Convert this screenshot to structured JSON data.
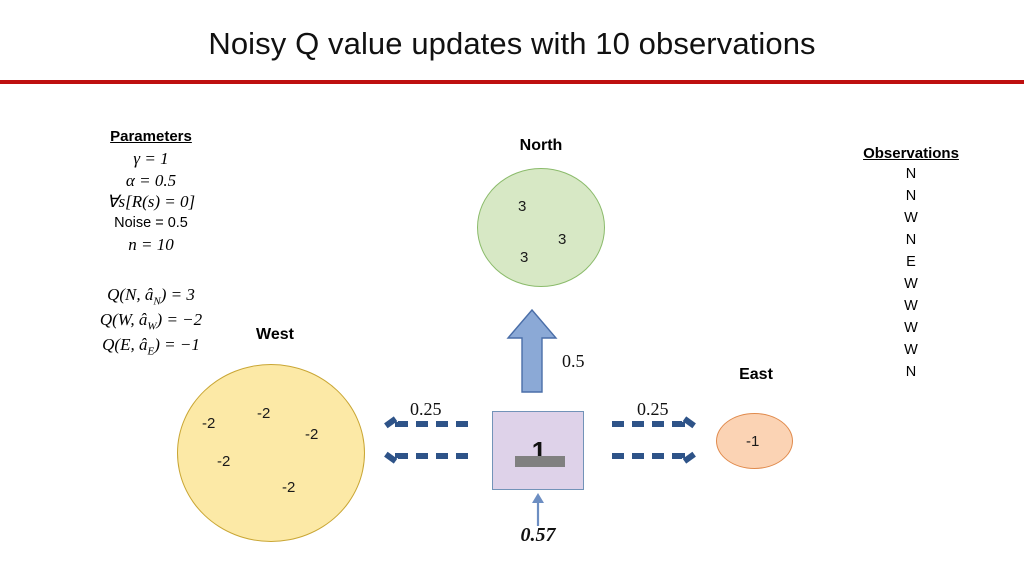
{
  "slide": {
    "title": "Noisy Q value updates with 10 observations",
    "accent_color": "#be0f0f"
  },
  "parameters": {
    "heading": "Parameters",
    "gamma_symbol": "γ",
    "gamma_value": "= 1",
    "alpha_symbol": "α",
    "alpha_value": "= 0.5",
    "reward_line": "∀s[R(s) = 0]",
    "noise_line": "Noise = 0.5",
    "n_symbol": "n",
    "n_value": "= 10"
  },
  "q_values": {
    "north": {
      "prefix": "Q(N, â",
      "sub": "N",
      "suffix": ") = 3"
    },
    "west": {
      "prefix": "Q(W, â",
      "sub": "W",
      "suffix": ") = −2"
    },
    "east": {
      "prefix": "Q(E, â",
      "sub": "E",
      "suffix": ") = −1"
    }
  },
  "observations": {
    "heading": "Observations",
    "items": [
      "N",
      "N",
      "W",
      "N",
      "E",
      "W",
      "W",
      "W",
      "W",
      "N"
    ]
  },
  "nodes": {
    "north": {
      "label": "North",
      "fill": "#d7e8c5",
      "stroke": "#8bbb6b",
      "values": [
        "3",
        "3",
        "3"
      ]
    },
    "west": {
      "label": "West",
      "fill": "#fce9a6",
      "stroke": "#c9a634",
      "values": [
        "-2",
        "-2",
        "-2",
        "-2",
        "-2"
      ]
    },
    "east": {
      "label": "East",
      "fill": "#fbd3b4",
      "stroke": "#e08a4c",
      "values": [
        "-1"
      ]
    }
  },
  "center": {
    "value": "1",
    "fill": "#ded2e9",
    "stroke": "#7293b8",
    "erased": true
  },
  "arrows": {
    "up": {
      "label": "0.5",
      "color": "#8ba9d6",
      "direction": "up"
    },
    "left": {
      "label": "0.25",
      "color": "#2e5388",
      "direction": "left",
      "style": "dashed"
    },
    "right": {
      "label": "0.25",
      "color": "#2e5388",
      "direction": "right",
      "style": "dashed"
    },
    "bottom": {
      "label": "0.57",
      "color": "#6d8ec2",
      "direction": "up"
    }
  }
}
